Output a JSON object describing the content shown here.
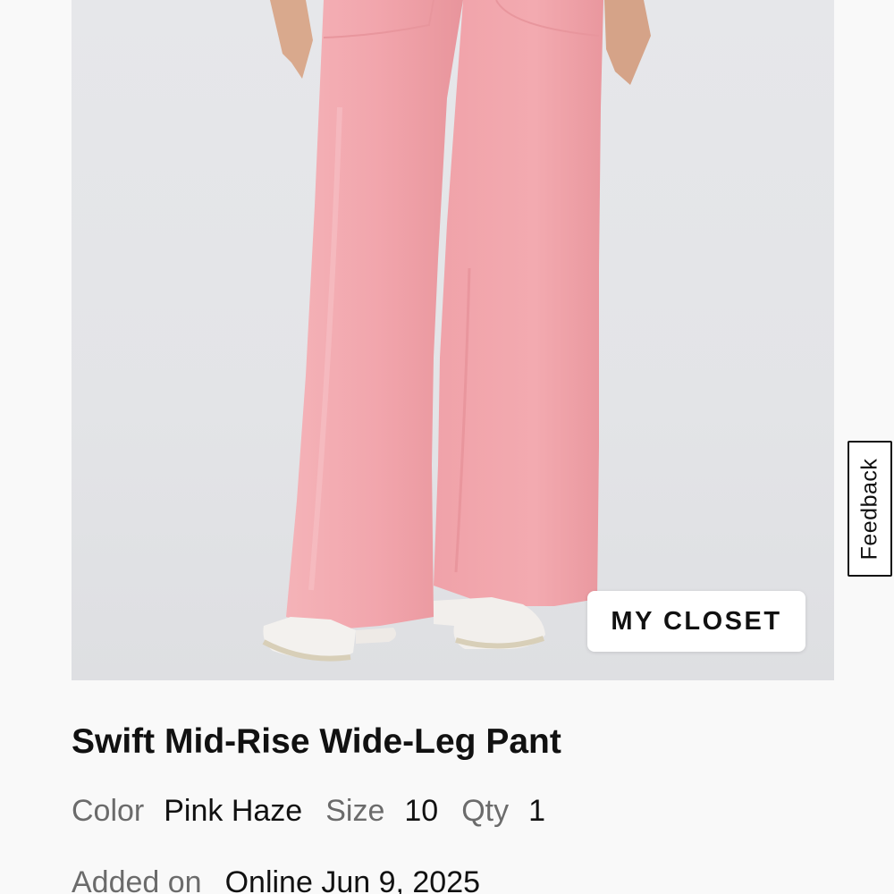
{
  "product": {
    "image_alt": "Model wearing pink wide-leg pants with white sneakers",
    "title": "Swift Mid-Rise Wide-Leg Pant",
    "color_label": "Color",
    "color_value": "Pink Haze",
    "size_label": "Size",
    "size_value": "10",
    "qty_label": "Qty",
    "qty_value": "1",
    "added_label": "Added on",
    "added_value": "Online Jun 9, 2025"
  },
  "actions": {
    "closet_label": "MY CLOSET",
    "feedback_label": "Feedback"
  },
  "colors": {
    "pant": "#f2a7ad",
    "background": "#f9f9f9",
    "image_bg": "#e4e5e8"
  }
}
